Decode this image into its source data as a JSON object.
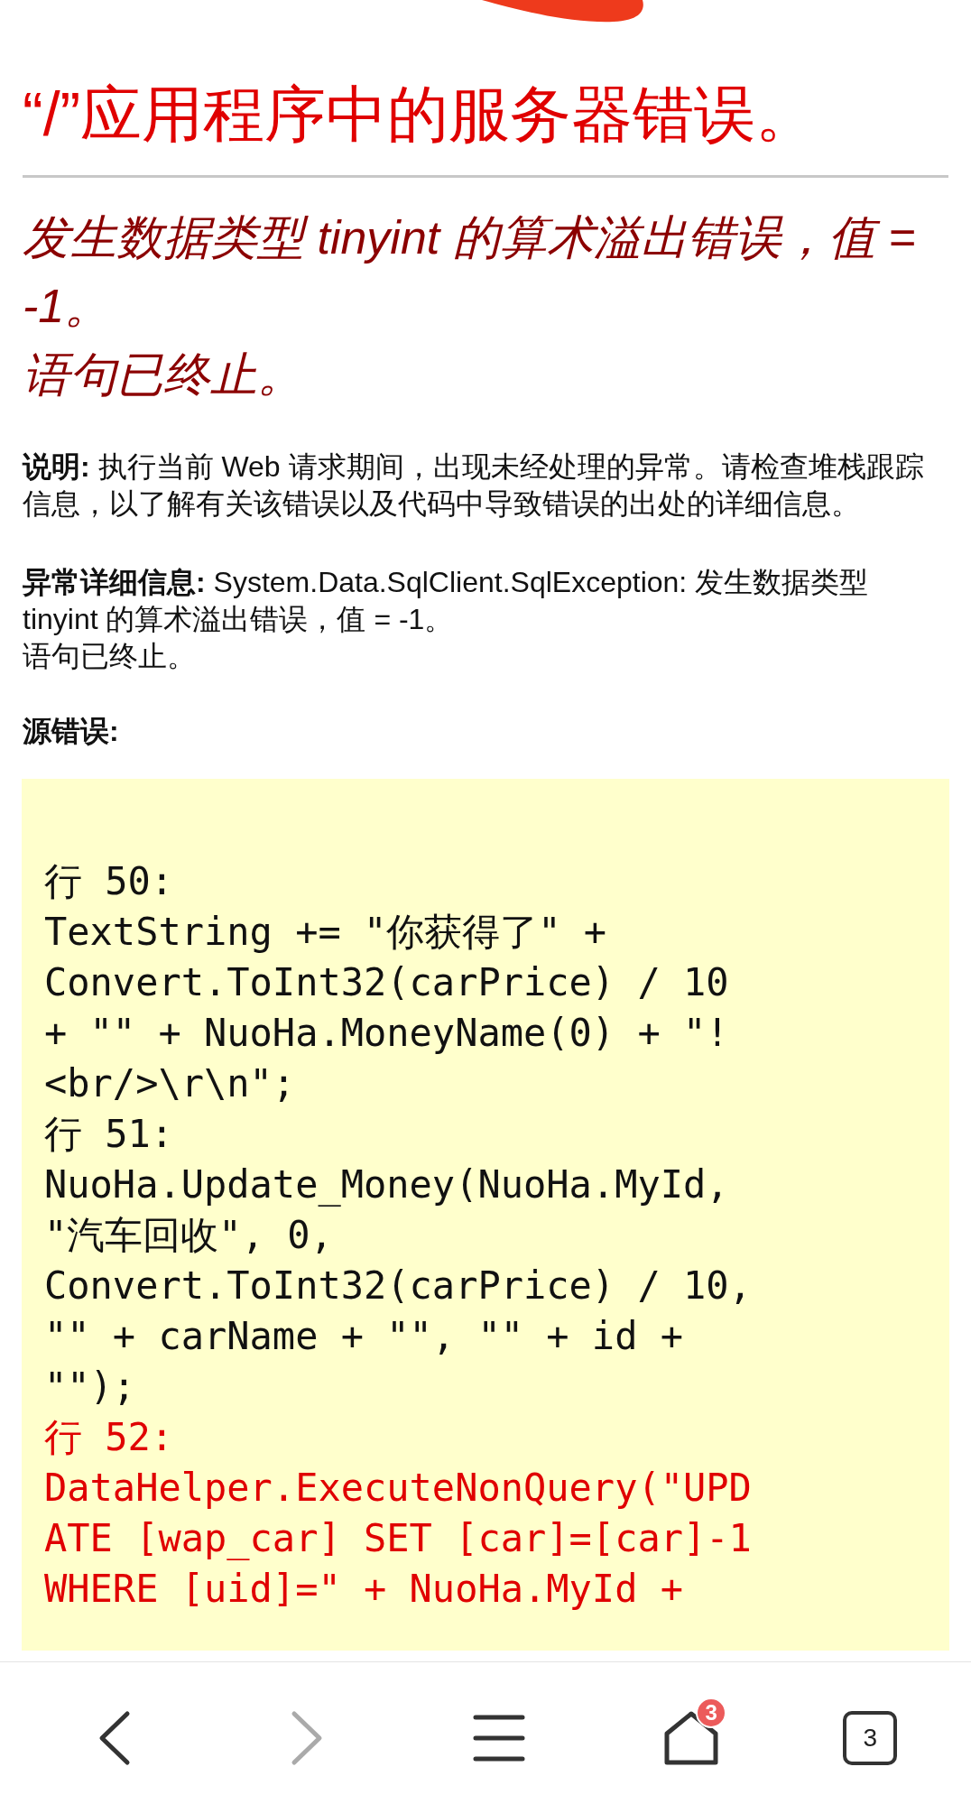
{
  "page": {
    "title": "“/”应用程序中的服务器错误。",
    "error_heading": [
      "发生数据类型 tinyint 的算术溢出错误，值 = -1。",
      "语句已终止。"
    ],
    "description": {
      "label": "说明:",
      "text": "执行当前 Web 请求期间，出现未经处理的异常。请检查堆栈跟踪信息，以了解有关该错误以及代码中导致错误的出处的详细信息。"
    },
    "exception_details": {
      "label": "异常详细信息:",
      "lines": [
        "System.Data.SqlClient.SqlException: 发生数据类型 tinyint 的算术溢出错误，值 = -1。",
        "语句已终止。"
      ]
    },
    "source_error_label": "源错误:",
    "source_code": [
      {
        "highlighted": false,
        "lines": [
          "行 50:",
          "TextString += \"你获得了\" +",
          "Convert.ToInt32(carPrice) / 10",
          "+ \"\" + NuoHa.MoneyName(0) + \"!",
          "<br/>\\r\\n\";"
        ]
      },
      {
        "highlighted": false,
        "lines": [
          "行 51:",
          "NuoHa.Update_Money(NuoHa.MyId,",
          "\"汽车回收\", 0,",
          "Convert.ToInt32(carPrice) / 10,",
          "\"\" + carName + \"\", \"\" + id +",
          "\"\");"
        ]
      },
      {
        "highlighted": true,
        "lines": [
          "行 52:",
          "DataHelper.ExecuteNonQuery(\"UPD",
          "ATE [wap_car] SET [car]=[car]-1",
          "WHERE [uid]=\" + NuoHa.MyId +"
        ]
      }
    ]
  },
  "nav_bar": {
    "back": {
      "disabled": false
    },
    "forward": {
      "disabled": true
    },
    "home_badge": "3",
    "tab_count": "3"
  }
}
